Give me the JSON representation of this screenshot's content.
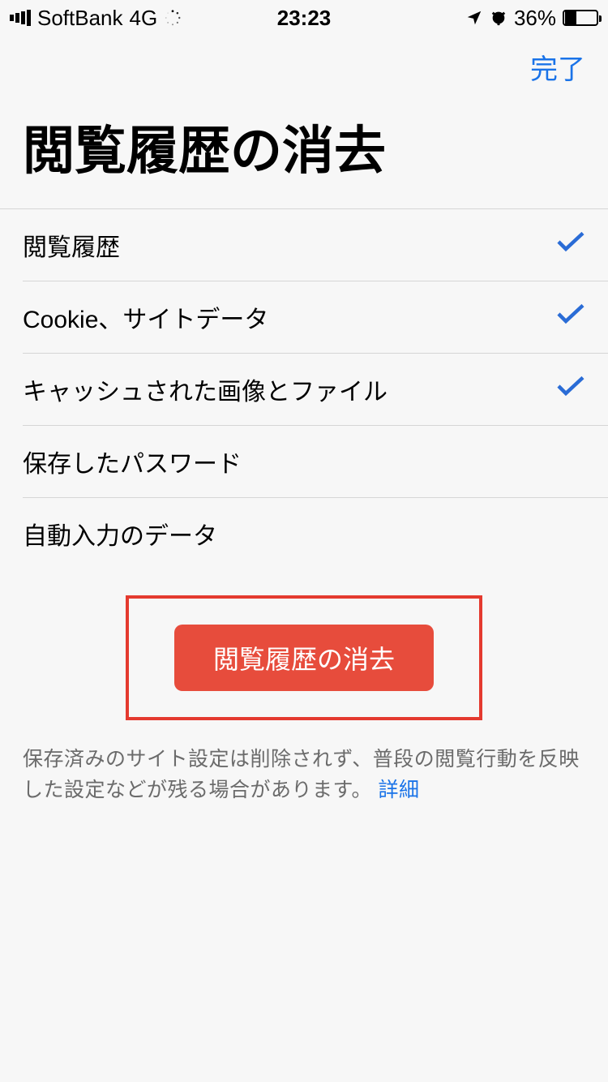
{
  "status": {
    "carrier": "SoftBank",
    "network": "4G",
    "time": "23:23",
    "battery_percent": "36%"
  },
  "nav": {
    "done": "完了"
  },
  "title": "閲覧履歴の消去",
  "items": [
    {
      "label": "閲覧履歴",
      "checked": true
    },
    {
      "label": "Cookie、サイトデータ",
      "checked": true
    },
    {
      "label": "キャッシュされた画像とファイル",
      "checked": true
    },
    {
      "label": "保存したパスワード",
      "checked": false
    },
    {
      "label": "自動入力のデータ",
      "checked": false
    }
  ],
  "button": {
    "label": "閲覧履歴の消去"
  },
  "footer": {
    "text": "保存済みのサイト設定は削除されず、普段の閲覧行動を反映した設定などが残る場合があります。",
    "more": "詳細"
  }
}
